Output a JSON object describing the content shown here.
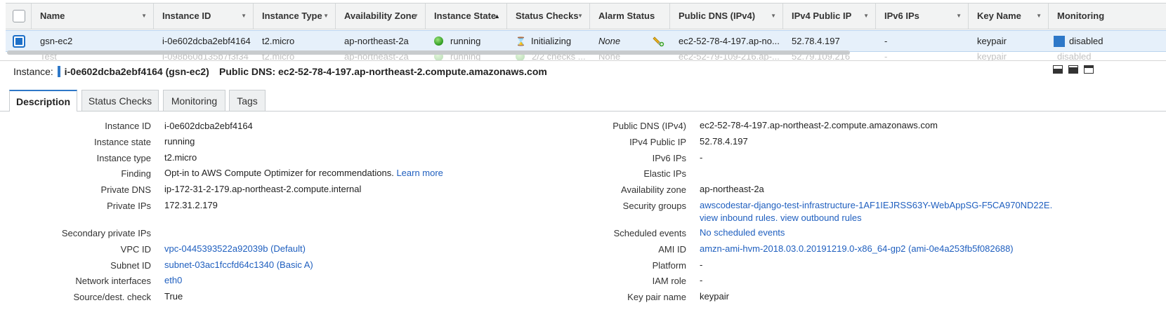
{
  "columns": {
    "name": "Name",
    "instance_id": "Instance ID",
    "instance_type": "Instance Type",
    "availability_zone": "Availability Zone",
    "instance_state": "Instance State",
    "status_checks": "Status Checks",
    "alarm_status": "Alarm Status",
    "public_dns": "Public DNS (IPv4)",
    "ipv4_public_ip": "IPv4 Public IP",
    "ipv6_ips": "IPv6 IPs",
    "key_name": "Key Name",
    "monitoring": "Monitoring"
  },
  "selected_row": {
    "name": "gsn-ec2",
    "instance_id": "i-0e602dcba2ebf4164",
    "instance_type": "t2.micro",
    "availability_zone": "ap-northeast-2a",
    "instance_state": "running",
    "status_checks": "Initializing",
    "alarm_status": "None",
    "public_dns": "ec2-52-78-4-197.ap-no...",
    "ipv4_public_ip": "52.78.4.197",
    "ipv6_ips": "-",
    "key_name": "keypair",
    "monitoring": "disabled"
  },
  "faded_row": {
    "name": "Test",
    "instance_id": "i-098b60d135b7f3f34",
    "instance_type": "t2.micro",
    "availability_zone": "ap-northeast-2a",
    "instance_state": "running",
    "status_checks": "2/2 checks ...",
    "alarm_status": "None",
    "public_dns": "ec2-52-79-109-216.ap-...",
    "ipv4_public_ip": "52.79.109.216",
    "ipv6_ips": "-",
    "key_name": "keypair",
    "monitoring": "disabled"
  },
  "detail_header": {
    "instance_label": "Instance:",
    "instance_value": "i-0e602dcba2ebf4164 (gsn-ec2)",
    "public_dns_label": "Public DNS:",
    "public_dns_value": "ec2-52-78-4-197.ap-northeast-2.compute.amazonaws.com"
  },
  "tabs": [
    "Description",
    "Status Checks",
    "Monitoring",
    "Tags"
  ],
  "description": {
    "left": [
      {
        "label": "Instance ID",
        "value": "i-0e602dcba2ebf4164"
      },
      {
        "label": "Instance state",
        "value": "running"
      },
      {
        "label": "Instance type",
        "value": "t2.micro"
      },
      {
        "label": "Finding",
        "value": "Opt-in to AWS Compute Optimizer for recommendations.",
        "link": "Learn more"
      },
      {
        "label": "Private DNS",
        "value": "ip-172-31-2-179.ap-northeast-2.compute.internal"
      },
      {
        "label": "Private IPs",
        "value": "172.31.2.179"
      },
      {
        "label": "Secondary private IPs",
        "value": ""
      },
      {
        "label": "VPC ID",
        "value": "vpc-0445393522a92039b (Default)"
      },
      {
        "label": "Subnet ID",
        "value": "subnet-03ac1fccfd64c1340 (Basic A)"
      },
      {
        "label": "Network interfaces",
        "value": "eth0"
      },
      {
        "label": "Source/dest. check",
        "value": "True"
      }
    ],
    "right": [
      {
        "label": "Public DNS (IPv4)",
        "value": "ec2-52-78-4-197.ap-northeast-2.compute.amazonaws.com"
      },
      {
        "label": "IPv4 Public IP",
        "value": "52.78.4.197"
      },
      {
        "label": "IPv6 IPs",
        "value": "-"
      },
      {
        "label": "Elastic IPs",
        "value": ""
      },
      {
        "label": "Availability zone",
        "value": "ap-northeast-2a"
      },
      {
        "label": "Security groups",
        "value": "awscodestar-django-test-infrastructure-1AF1IEJRSS63Y-WebAppSG-F5CA970ND22E.",
        "links": [
          "view inbound rules",
          "view outbound rules"
        ]
      },
      {
        "label": "Scheduled events",
        "value": "No scheduled events"
      },
      {
        "label": "AMI ID",
        "value": "amzn-ami-hvm-2018.03.0.20191219.0-x86_64-gp2 (ami-0e4a253fb5f082688)"
      },
      {
        "label": "Platform",
        "value": "-"
      },
      {
        "label": "IAM role",
        "value": "-"
      },
      {
        "label": "Key pair name",
        "value": "keypair"
      }
    ]
  },
  "colors": {
    "selected_row_bg": "#e6f0fa",
    "link": "#1f5fbf",
    "accent": "#2e78c8",
    "header_bg": "#f2f3f3"
  }
}
